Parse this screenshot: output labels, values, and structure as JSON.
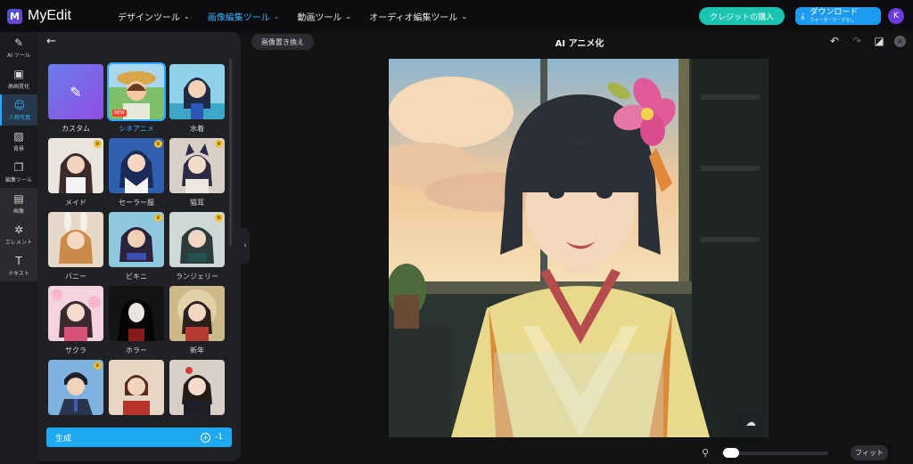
{
  "app": {
    "name": "MyEdit",
    "logo_letter": "M"
  },
  "nav": [
    {
      "label": "デザインツール",
      "active": false
    },
    {
      "label": "画像編集ツール",
      "active": true
    },
    {
      "label": "動画ツール",
      "active": false
    },
    {
      "label": "オーディオ編集ツール",
      "active": false
    }
  ],
  "header": {
    "credit_button": "クレジットの購入",
    "download_main": "ダウンロード",
    "download_sub": "ウォーターマークなし",
    "avatar_initial": "K"
  },
  "rail": [
    {
      "label": "AI ツール",
      "icon": "✎"
    },
    {
      "label": "高画質化",
      "icon": "▣"
    },
    {
      "label": "人物写真",
      "icon": "☺"
    },
    {
      "label": "背景",
      "icon": "▨"
    },
    {
      "label": "編集ツール",
      "icon": "❐"
    },
    {
      "label": "画像",
      "icon": "▤"
    },
    {
      "label": "エレメント",
      "icon": "✲"
    },
    {
      "label": "テキスト",
      "icon": "T"
    }
  ],
  "styles": [
    {
      "label": "カスタム",
      "new": false,
      "premium": false
    },
    {
      "label": "シネアニメ",
      "new": true,
      "premium": false
    },
    {
      "label": "水着",
      "new": false,
      "premium": false
    },
    {
      "label": "メイド",
      "new": false,
      "premium": true
    },
    {
      "label": "セーラー服",
      "new": false,
      "premium": true
    },
    {
      "label": "猫耳",
      "new": false,
      "premium": true
    },
    {
      "label": "バニー",
      "new": false,
      "premium": false
    },
    {
      "label": "ビキニ",
      "new": false,
      "premium": true
    },
    {
      "label": "ランジェリー",
      "new": false,
      "premium": true
    },
    {
      "label": "サクラ",
      "new": false,
      "premium": false
    },
    {
      "label": "ホラー",
      "new": false,
      "premium": false
    },
    {
      "label": "新年",
      "new": false,
      "premium": false
    },
    {
      "label": "",
      "new": false,
      "premium": true
    },
    {
      "label": "",
      "new": false,
      "premium": false
    },
    {
      "label": "",
      "new": false,
      "premium": false
    }
  ],
  "badges": {
    "new_label": "NEW",
    "premium_glyph": "♛"
  },
  "panel": {
    "generate_label": "生成",
    "generate_cost": "-1"
  },
  "canvas": {
    "replace_button": "画像置き換え",
    "title": "AI アニメ化",
    "fit_button": "フィット",
    "zoom_fraction": 0.02
  },
  "colors": {
    "accent": "#1ea9f0",
    "credit": "#19c5b0",
    "avatar": "#6c3ce0"
  }
}
